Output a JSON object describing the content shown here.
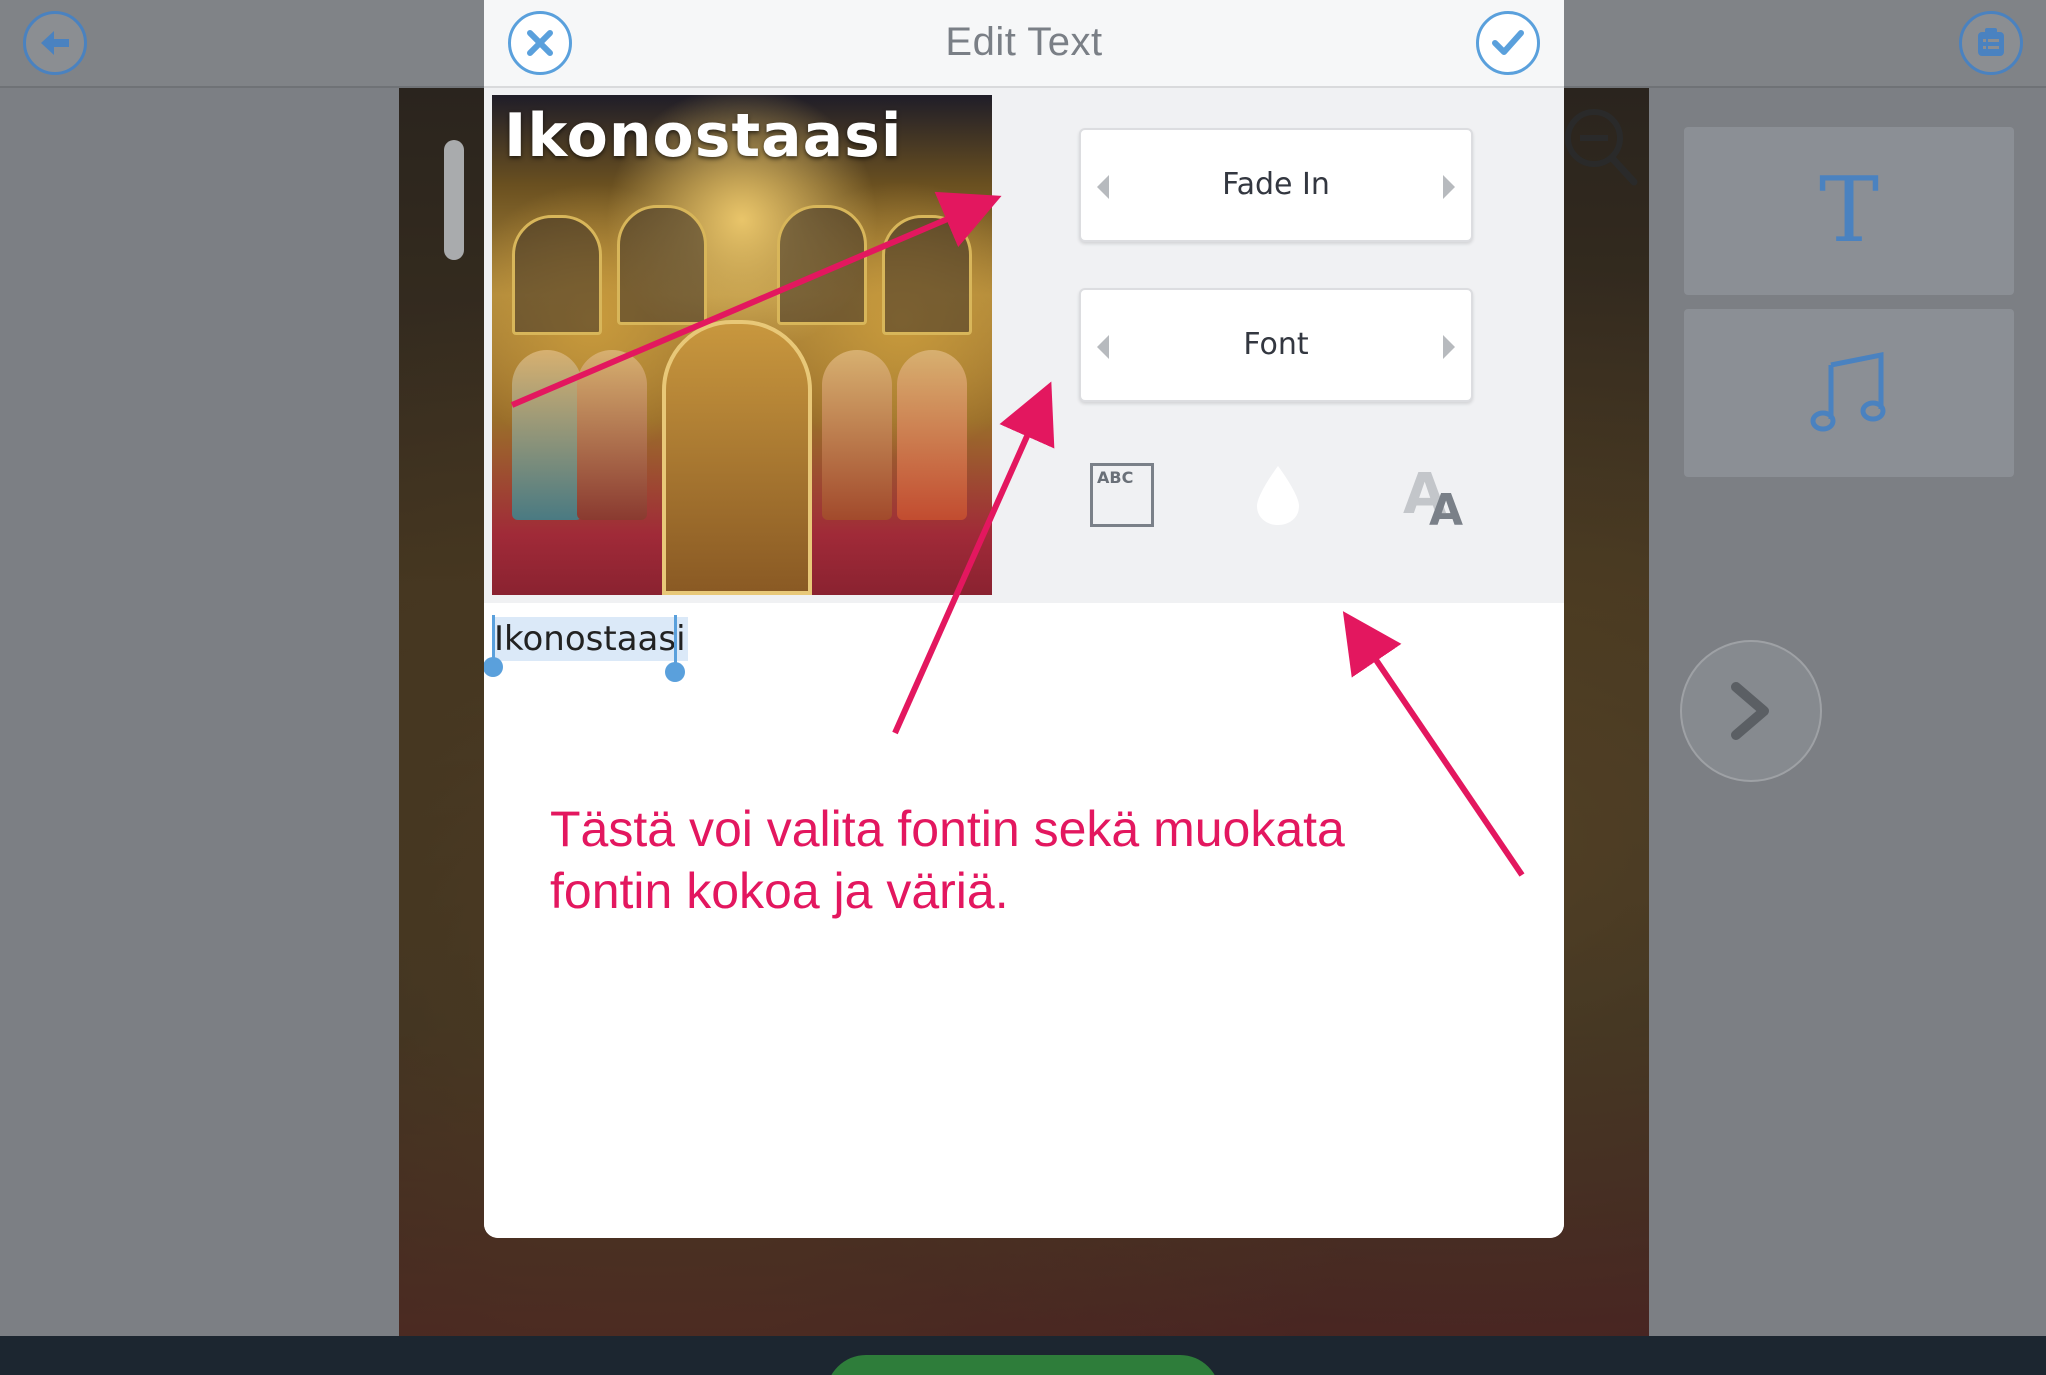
{
  "modal": {
    "title": "Edit Text",
    "preview_text": "Ikonostaasi",
    "animation_selector": "Fade In",
    "font_selector": "Font",
    "bg_icon_label": "ABC",
    "text_value": "Ikonostaasi"
  },
  "sidebar": {
    "text_tile_glyph": "T"
  },
  "annotation": {
    "text": "Tästä voi valita fontin sekä muokata fontin kokoa ja väriä.",
    "color": "#e3175f"
  },
  "icons": {
    "back": "arrow-left-icon",
    "clipboard": "clipboard-list-icon",
    "cancel": "close-icon",
    "confirm": "check-icon",
    "zoom": "zoom-out-icon",
    "music": "music-note-icon",
    "next": "chevron-right-icon",
    "background": "text-background-icon",
    "color": "color-drop-icon",
    "size": "font-size-icon"
  },
  "colors": {
    "accent": "#4a82c0",
    "selection": "#5aa0dc"
  }
}
